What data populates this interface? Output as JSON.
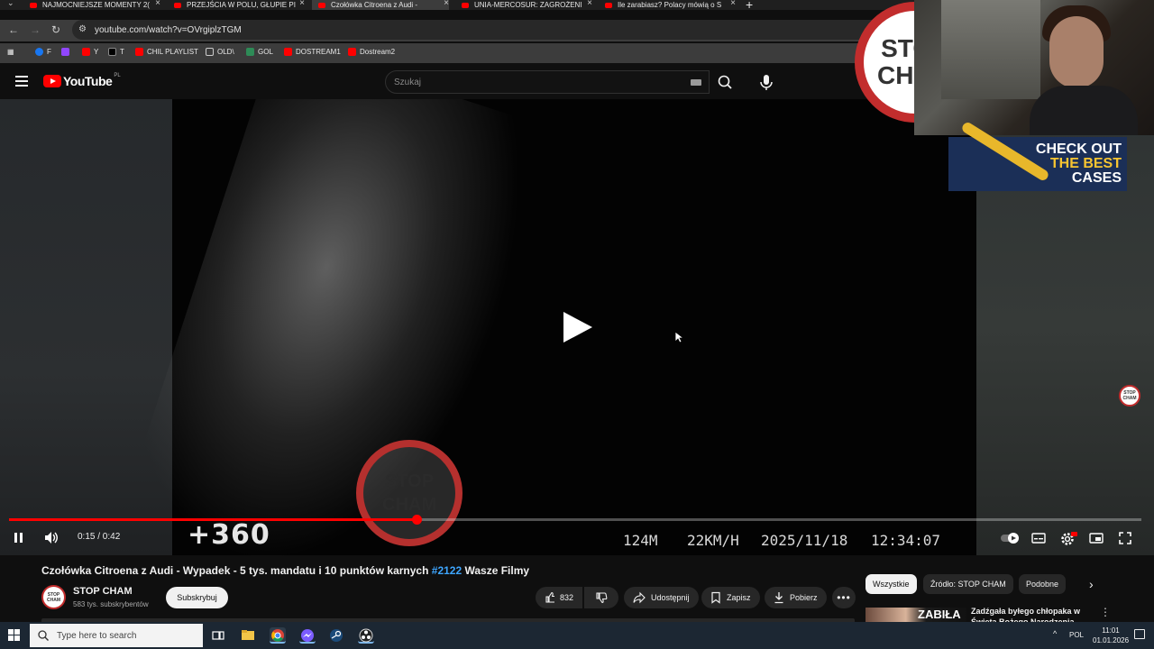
{
  "browser": {
    "tabs": [
      {
        "label": "NAJMOCNIEJSZE MOMENTY 2(",
        "active": false
      },
      {
        "label": "PRZEJŚCIA W POLU, GŁUPIE PI",
        "active": false
      },
      {
        "label": "Czołówka Citroena z Audi -",
        "active": true
      },
      {
        "label": "UNIA-MERCOSUR: ZAGROŻENI",
        "active": false
      },
      {
        "label": "Ile zarabiasz? Polacy mówią o S",
        "active": false
      }
    ],
    "url": "youtube.com/watch?v=OVrgiplzTGM",
    "bookmarks": [
      {
        "label": "F",
        "icon": "facebook-icon",
        "color": "#1877f2"
      },
      {
        "label": "",
        "icon": "twitch-icon",
        "color": "#9146ff"
      },
      {
        "label": "Y",
        "icon": "youtube-icon",
        "color": "#ff0000"
      },
      {
        "label": "T",
        "icon": "x-icon",
        "color": "#000000"
      },
      {
        "label": "CHIL PLAYLIST",
        "icon": "youtube-icon",
        "color": "#ff0000"
      },
      {
        "label": "OLD\\",
        "icon": "folder-icon",
        "color": "#3c3c3c"
      },
      {
        "label": "GOL",
        "icon": "gol-icon",
        "color": "#2e8b57"
      },
      {
        "label": "DOSTREAM1",
        "icon": "youtube-icon",
        "color": "#ff0000"
      },
      {
        "label": "Dostream2",
        "icon": "youtube-icon",
        "color": "#ff0000"
      }
    ]
  },
  "youtube": {
    "logo_text": "YouTube",
    "country": "PL",
    "search_placeholder": "Szukaj"
  },
  "video": {
    "overlay_logo": "+360",
    "osd": {
      "distance": "124M",
      "speed": "22KM/H",
      "date": "2025/11/18",
      "time": "12:34:07"
    },
    "stamp_line1": "STOP",
    "stamp_line2": "CHAM",
    "ad_line1": "CHECK OUT",
    "ad_line2": "THE BEST",
    "ad_line3": "CASES",
    "progress_fraction": 0.36,
    "time_current": "0:15",
    "time_total": "0:42",
    "time_display": "0:15 / 0:42"
  },
  "below": {
    "title": "Czołówka Citroena z Audi - Wypadek - 5 tys. mandatu i 10 punktów karnych",
    "hashtag": "#2122",
    "title_tail": "Wasze Filmy",
    "channel_name": "STOP CHAM",
    "channel_subs": "583 tys. subskrybentów",
    "subscribe_label": "Subskrybuj",
    "likes": "832",
    "share_label": "Udostępnij",
    "save_label": "Zapisz",
    "download_label": "Pobierz",
    "chips": [
      "Wszystkie",
      "Źródło: STOP CHAM",
      "Podobne"
    ],
    "rec_title": "Zadźgała byłego chłopaka w Święta Bożego Narodzenia",
    "rec_thumb_text": "ZABIŁA"
  },
  "taskbar": {
    "search_placeholder": "Type here to search",
    "lang": "POL",
    "time": "11:01",
    "date": "01.01.2026"
  }
}
